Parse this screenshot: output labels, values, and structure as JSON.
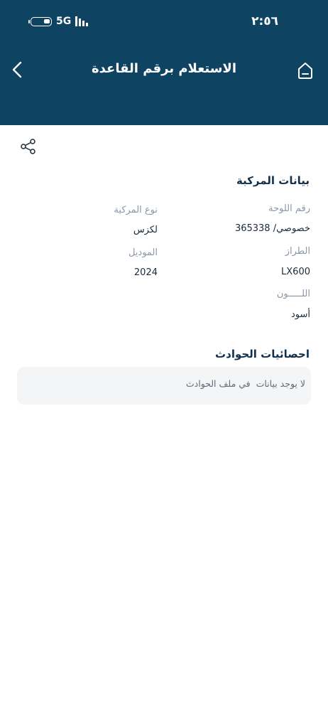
{
  "status_bar": {
    "time": "٢:٥٦",
    "network": "5G"
  },
  "header": {
    "title": "الاستعلام برقم القاعدة",
    "background_color": "#0f4362"
  },
  "vehicle": {
    "section_title": "بيانات المركبة",
    "plate_label": "رقم اللوحة",
    "plate_value": "خصوصي/ 365338",
    "type_label": "نوع المركبة",
    "type_value": "لكزس",
    "model_label": "الطراز",
    "model_value": "LX600",
    "year_label": "الموديل",
    "year_value": "2024",
    "color_label": "اللـــــون",
    "color_value": "أسود"
  },
  "accidents": {
    "section_title": "احصائيات الحوادث",
    "empty_message": "لا يوجد بيانات  في ملف الحوادث"
  },
  "icons": {
    "back": "chevron-left-icon",
    "home": "home-icon",
    "share": "share-icon"
  }
}
